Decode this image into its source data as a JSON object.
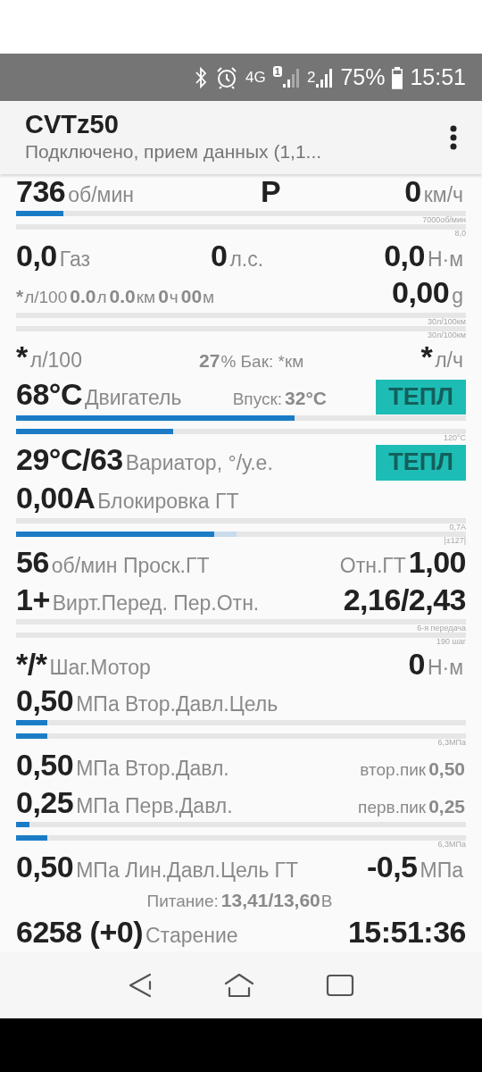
{
  "status_bar": {
    "network": "4G",
    "sim_1": "1",
    "sim_2": "2",
    "battery": "75%",
    "time": "15:51"
  },
  "app_bar": {
    "title": "CVTz50",
    "subtitle": "Подключено, прием данных (1,1..."
  },
  "rows": [
    {
      "kind": "readout",
      "left": [
        {
          "text": "736",
          "kind": "value"
        },
        {
          "text": "об/мин",
          "kind": "unit"
        }
      ],
      "center": [
        {
          "text": "P",
          "kind": "value"
        }
      ],
      "right": [
        {
          "text": "0",
          "kind": "value"
        },
        {
          "text": "км/ч",
          "kind": "unit"
        }
      ]
    },
    {
      "kind": "bars",
      "bars": [
        {
          "level": 0.105,
          "caption": "7000об/мин"
        },
        {
          "level": 0,
          "caption": "8,0"
        }
      ]
    },
    {
      "kind": "readout",
      "left": [
        {
          "text": "0,0",
          "kind": "value"
        },
        {
          "text": "Газ",
          "kind": "unit"
        }
      ],
      "center": [
        {
          "text": "0",
          "kind": "value"
        },
        {
          "text": "л.с.",
          "kind": "unit"
        }
      ],
      "right": [
        {
          "text": "0,0",
          "kind": "value"
        },
        {
          "text": "Н·м",
          "kind": "unit"
        }
      ]
    },
    {
      "kind": "readout",
      "left": [
        {
          "text": "*",
          "kind": "note-bold"
        },
        {
          "text": "л/100",
          "kind": "note"
        },
        {
          "text": "0.0",
          "kind": "note-bold"
        },
        {
          "text": "л",
          "kind": "note"
        },
        {
          "text": "0.0",
          "kind": "note-bold"
        },
        {
          "text": "км",
          "kind": "note"
        },
        {
          "text": "0",
          "kind": "note-bold"
        },
        {
          "text": "ч",
          "kind": "note"
        },
        {
          "text": "00",
          "kind": "note-bold"
        },
        {
          "text": "м",
          "kind": "note"
        }
      ],
      "right": [
        {
          "text": "0,00",
          "kind": "value"
        },
        {
          "text": "g",
          "kind": "unit"
        }
      ]
    },
    {
      "kind": "bars",
      "bars": [
        {
          "level": 0,
          "caption": "30л/100км"
        },
        {
          "level": 0,
          "caption": "30л/100км"
        }
      ]
    },
    {
      "kind": "readout",
      "left": [
        {
          "text": "*",
          "kind": "value"
        },
        {
          "text": "л/100",
          "kind": "unit"
        }
      ],
      "center": [
        {
          "text": "27",
          "kind": "note-bold"
        },
        {
          "text": "% Бак: *км",
          "kind": "note"
        }
      ],
      "right": [
        {
          "text": "*",
          "kind": "value"
        },
        {
          "text": "л/ч",
          "kind": "unit"
        }
      ]
    },
    {
      "kind": "readout",
      "left": [
        {
          "text": "68°C",
          "kind": "value"
        },
        {
          "text": "Двигатель",
          "kind": "unit"
        }
      ],
      "center": [
        {
          "text": "Впуск:",
          "kind": "note"
        },
        {
          "text": "32°C",
          "kind": "note-bold"
        }
      ],
      "right": [
        {
          "text": "ТЕПЛ",
          "kind": "button"
        }
      ]
    },
    {
      "kind": "bars",
      "bars": [
        {
          "level": 0.62
        },
        {
          "level": 0.35,
          "caption": "120°C"
        }
      ]
    },
    {
      "kind": "readout",
      "left": [
        {
          "text": "29°C/63",
          "kind": "value"
        },
        {
          "text": "Вариатор, °/у.е.",
          "kind": "unit"
        }
      ],
      "right": [
        {
          "text": "ТЕПЛ",
          "kind": "button"
        }
      ]
    },
    {
      "kind": "readout",
      "left": [
        {
          "text": "0,00A",
          "kind": "value"
        },
        {
          "text": "Блокировка ГТ",
          "kind": "unit"
        }
      ]
    },
    {
      "kind": "bars",
      "bars": [
        {
          "level": 0,
          "caption": "0,7A"
        },
        {
          "level": 0.44,
          "buffer": {
            "level": 0.49
          },
          "caption": "|±127|"
        }
      ]
    },
    {
      "kind": "readout",
      "left": [
        {
          "text": "56",
          "kind": "value"
        },
        {
          "text": "об/мин Проск.ГТ",
          "kind": "unit"
        }
      ],
      "right": [
        {
          "text": "Отн.ГТ",
          "kind": "unit"
        },
        {
          "text": "1,00",
          "kind": "value"
        }
      ]
    },
    {
      "kind": "readout",
      "left": [
        {
          "text": "1+",
          "kind": "value"
        },
        {
          "text": "Вирт.Перед. Пер.Отн.",
          "kind": "unit"
        }
      ],
      "right": [
        {
          "text": "2,16/2,43",
          "kind": "value"
        }
      ]
    },
    {
      "kind": "bars",
      "bars": [
        {
          "level": 0,
          "caption": "6-я передача"
        },
        {
          "level": 0,
          "caption": "190 шаг"
        }
      ]
    },
    {
      "kind": "readout",
      "left": [
        {
          "text": "*/*",
          "kind": "value"
        },
        {
          "text": "Шаг.Мотор",
          "kind": "unit"
        }
      ],
      "right": [
        {
          "text": "0",
          "kind": "value"
        },
        {
          "text": "Н·м",
          "kind": "unit"
        }
      ]
    },
    {
      "kind": "readout",
      "left": [
        {
          "text": "0,50",
          "kind": "value"
        },
        {
          "text": "МПа Втор.Давл.Цель",
          "kind": "unit"
        }
      ]
    },
    {
      "kind": "bars",
      "bars": [
        {
          "level": 0.07
        },
        {
          "level": 0.07,
          "caption": "6,3МПа"
        }
      ]
    },
    {
      "kind": "readout",
      "left": [
        {
          "text": "0,50",
          "kind": "value"
        },
        {
          "text": "МПа Втор.Давл.",
          "kind": "unit"
        }
      ],
      "right": [
        {
          "text": "втор.пик",
          "kind": "note"
        },
        {
          "text": "0,50",
          "kind": "note-bold"
        }
      ]
    },
    {
      "kind": "readout",
      "left": [
        {
          "text": "0,25",
          "kind": "value"
        },
        {
          "text": "МПа Перв.Давл.",
          "kind": "unit"
        }
      ],
      "right": [
        {
          "text": "перв.пик",
          "kind": "note"
        },
        {
          "text": "0,25",
          "kind": "note-bold"
        }
      ]
    },
    {
      "kind": "bars",
      "bars": [
        {
          "level": 0.03
        },
        {
          "level": 0.07,
          "caption": "6,3МПа"
        }
      ]
    },
    {
      "kind": "readout",
      "left": [
        {
          "text": "0,50",
          "kind": "value"
        },
        {
          "text": "МПа Лин.Давл.Цель",
          "kind": "unit"
        },
        {
          "text": "ГТ",
          "kind": "unit"
        }
      ],
      "right": [
        {
          "text": "-0,5",
          "kind": "value"
        },
        {
          "text": "МПа",
          "kind": "unit"
        }
      ]
    },
    {
      "kind": "readout",
      "center": [
        {
          "text": "Питание:",
          "kind": "note"
        },
        {
          "text": "13,41/13,60",
          "kind": "note-bold"
        },
        {
          "text": "В",
          "kind": "note"
        }
      ]
    },
    {
      "kind": "readout",
      "left": [
        {
          "text": "6258 (+0)",
          "kind": "value"
        },
        {
          "text": "Старение",
          "kind": "unit"
        }
      ],
      "right": [
        {
          "text": "15:51:36",
          "kind": "value"
        }
      ]
    }
  ]
}
